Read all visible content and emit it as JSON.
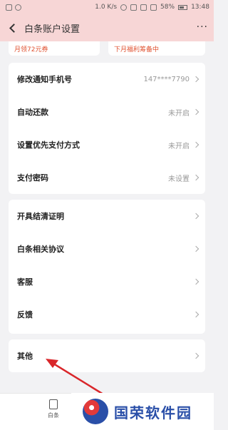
{
  "status_bar": {
    "speed": "1.0 K/s",
    "battery": "58%",
    "time": "13:48"
  },
  "nav": {
    "title": "白条账户设置",
    "more": "···"
  },
  "promo": {
    "left": "月领72元券",
    "right": "下月福利筹备中"
  },
  "settings_group_1": [
    {
      "label": "修改通知手机号",
      "value": "147****7790"
    },
    {
      "label": "自动还款",
      "value": "未开启"
    },
    {
      "label": "设置优先支付方式",
      "value": "未开启"
    },
    {
      "label": "支付密码",
      "value": "未设置"
    }
  ],
  "settings_group_2": [
    {
      "label": "开具结清证明"
    },
    {
      "label": "白条相关协议"
    },
    {
      "label": "客服"
    },
    {
      "label": "反馈"
    }
  ],
  "settings_group_3": [
    {
      "label": "其他"
    }
  ],
  "bottom_nav": {
    "tab_label": "白条"
  },
  "watermark": {
    "text": "国荣软件园"
  },
  "colors": {
    "header_bg": "#f7d6d6",
    "accent": "#e0502f",
    "arrow": "#d9262a"
  }
}
